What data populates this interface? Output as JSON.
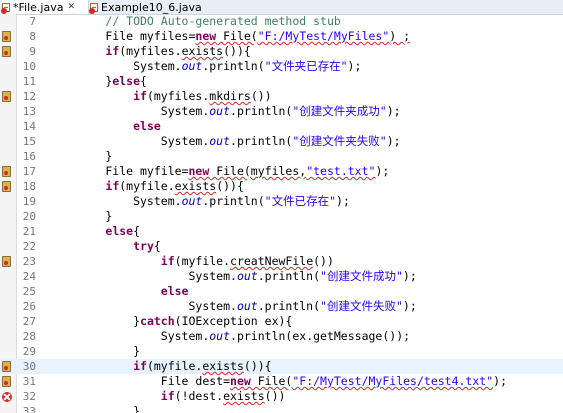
{
  "tabs": [
    {
      "label": "*File.java",
      "close": "✕"
    },
    {
      "label": "Example10_6.java",
      "close": ""
    }
  ],
  "lines": [
    {
      "num": "7",
      "marker": "",
      "segs": [
        {
          "t": "        "
        },
        {
          "t": "// TODO Auto-generated method stub",
          "c": "cm"
        }
      ]
    },
    {
      "num": "8",
      "marker": "warn",
      "segs": [
        {
          "t": "        File myfiles="
        },
        {
          "t": "new",
          "c": "kw sq"
        },
        {
          "t": " File(",
          "c": "sq"
        },
        {
          "t": "\"F:/MyTest/MyFiles\"",
          "c": "str sq"
        },
        {
          "t": ") ;",
          "c": "sq"
        }
      ]
    },
    {
      "num": "9",
      "marker": "warn",
      "segs": [
        {
          "t": "        "
        },
        {
          "t": "if",
          "c": "kw"
        },
        {
          "t": "(myfiles."
        },
        {
          "t": "exists",
          "c": "sq"
        },
        {
          "t": "()){"
        }
      ]
    },
    {
      "num": "10",
      "marker": "",
      "segs": [
        {
          "t": "            System."
        },
        {
          "t": "out",
          "c": "fld"
        },
        {
          "t": ".println("
        },
        {
          "t": "\"文件夹已存在\"",
          "c": "str"
        },
        {
          "t": ");"
        }
      ]
    },
    {
      "num": "11",
      "marker": "",
      "segs": [
        {
          "t": "        }"
        },
        {
          "t": "else",
          "c": "kw"
        },
        {
          "t": "{"
        }
      ]
    },
    {
      "num": "12",
      "marker": "warn",
      "segs": [
        {
          "t": "            "
        },
        {
          "t": "if",
          "c": "kw"
        },
        {
          "t": "(myfiles."
        },
        {
          "t": "mkdirs",
          "c": "sq"
        },
        {
          "t": "())"
        }
      ]
    },
    {
      "num": "13",
      "marker": "",
      "segs": [
        {
          "t": "                System."
        },
        {
          "t": "out",
          "c": "fld"
        },
        {
          "t": ".println("
        },
        {
          "t": "\"创建文件夹成功\"",
          "c": "str"
        },
        {
          "t": ");"
        }
      ]
    },
    {
      "num": "14",
      "marker": "",
      "segs": [
        {
          "t": "            "
        },
        {
          "t": "else",
          "c": "kw"
        }
      ]
    },
    {
      "num": "15",
      "marker": "",
      "segs": [
        {
          "t": "                System."
        },
        {
          "t": "out",
          "c": "fld"
        },
        {
          "t": ".println("
        },
        {
          "t": "\"创建文件夹失败\"",
          "c": "str"
        },
        {
          "t": ");"
        }
      ]
    },
    {
      "num": "16",
      "marker": "",
      "segs": [
        {
          "t": "        }"
        }
      ]
    },
    {
      "num": "17",
      "marker": "warn",
      "segs": [
        {
          "t": "        File myfile="
        },
        {
          "t": "new",
          "c": "kw sq"
        },
        {
          "t": " File(myfiles,",
          "c": "sq"
        },
        {
          "t": "\"test.txt\"",
          "c": "str sq"
        },
        {
          "t": ");"
        }
      ]
    },
    {
      "num": "18",
      "marker": "warn",
      "segs": [
        {
          "t": "        "
        },
        {
          "t": "if",
          "c": "kw"
        },
        {
          "t": "(myfile."
        },
        {
          "t": "exists",
          "c": "sq"
        },
        {
          "t": "()){"
        }
      ]
    },
    {
      "num": "19",
      "marker": "",
      "segs": [
        {
          "t": "            System."
        },
        {
          "t": "out",
          "c": "fld"
        },
        {
          "t": ".println("
        },
        {
          "t": "\"文件已存在\"",
          "c": "str"
        },
        {
          "t": ");"
        }
      ]
    },
    {
      "num": "20",
      "marker": "",
      "segs": [
        {
          "t": "        }"
        }
      ]
    },
    {
      "num": "21",
      "marker": "",
      "segs": [
        {
          "t": "        "
        },
        {
          "t": "else",
          "c": "kw"
        },
        {
          "t": "{"
        }
      ]
    },
    {
      "num": "22",
      "marker": "",
      "segs": [
        {
          "t": "            "
        },
        {
          "t": "try",
          "c": "kw"
        },
        {
          "t": "{"
        }
      ]
    },
    {
      "num": "23",
      "marker": "warn",
      "segs": [
        {
          "t": "                "
        },
        {
          "t": "if",
          "c": "kw"
        },
        {
          "t": "(myfile."
        },
        {
          "t": "creatNewFile",
          "c": "sq"
        },
        {
          "t": "())"
        }
      ]
    },
    {
      "num": "24",
      "marker": "",
      "segs": [
        {
          "t": "                    System."
        },
        {
          "t": "out",
          "c": "fld"
        },
        {
          "t": ".println("
        },
        {
          "t": "\"创建文件成功\"",
          "c": "str"
        },
        {
          "t": ");"
        }
      ]
    },
    {
      "num": "25",
      "marker": "",
      "segs": [
        {
          "t": "                "
        },
        {
          "t": "else",
          "c": "kw"
        }
      ]
    },
    {
      "num": "26",
      "marker": "",
      "segs": [
        {
          "t": "                    System."
        },
        {
          "t": "out",
          "c": "fld"
        },
        {
          "t": ".println("
        },
        {
          "t": "\"创建文件失败\"",
          "c": "str"
        },
        {
          "t": ");"
        }
      ]
    },
    {
      "num": "27",
      "marker": "",
      "segs": [
        {
          "t": "            }"
        },
        {
          "t": "catch",
          "c": "kw"
        },
        {
          "t": "(IOException ex){"
        }
      ]
    },
    {
      "num": "28",
      "marker": "",
      "segs": [
        {
          "t": "                System."
        },
        {
          "t": "out",
          "c": "fld"
        },
        {
          "t": ".println(ex.getMessage());"
        }
      ]
    },
    {
      "num": "29",
      "marker": "",
      "segs": [
        {
          "t": "            }"
        }
      ]
    },
    {
      "num": "30",
      "marker": "warn",
      "current": true,
      "segs": [
        {
          "t": "            "
        },
        {
          "t": "if",
          "c": "kw"
        },
        {
          "t": "(myfile."
        },
        {
          "t": "exists",
          "c": "sq"
        },
        {
          "t": "()){"
        }
      ]
    },
    {
      "num": "31",
      "marker": "warn",
      "segs": [
        {
          "t": "                File dest="
        },
        {
          "t": "new",
          "c": "kw sq"
        },
        {
          "t": " File(",
          "c": "sq"
        },
        {
          "t": "\"F:/MyTest/MyFiles/test4.txt\"",
          "c": "str sq"
        },
        {
          "t": ");"
        }
      ]
    },
    {
      "num": "32",
      "marker": "error",
      "segs": [
        {
          "t": "                "
        },
        {
          "t": "if",
          "c": "kw"
        },
        {
          "t": "(!dest."
        },
        {
          "t": "exists",
          "c": "sq"
        },
        {
          "t": "())"
        }
      ]
    },
    {
      "num": "33",
      "marker": "",
      "segs": [
        {
          "t": "            }"
        }
      ]
    }
  ]
}
